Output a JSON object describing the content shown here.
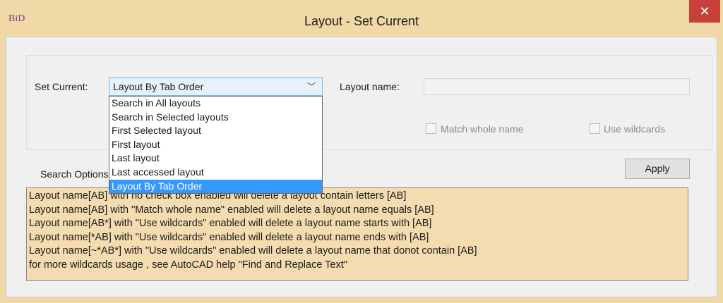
{
  "window": {
    "logo": "BiD",
    "title": "Layout - Set Current",
    "close_glyph": "✕"
  },
  "form": {
    "set_current_label": "Set Current:",
    "set_current_value": "Layout By Tab Order",
    "dropdown_arrow": "﹀",
    "layout_name_label": "Layout name:",
    "layout_name_value": "",
    "match_whole_name_label": "Match whole name",
    "use_wildcards_label": "Use wildcards",
    "search_options_label": "Search Options",
    "apply_label": "Apply"
  },
  "dropdown": {
    "options": [
      "Search in All layouts",
      "Search in Selected layouts",
      "First Selected layout",
      "First layout",
      "Last layout",
      "Last accessed layout",
      "Layout By Tab Order"
    ],
    "selected": "Layout By Tab Order"
  },
  "help_lines": [
    "Layout name[AB] with no check box enabled will delete a layout contain letters [AB]",
    "Layout name[AB] with \"Match whole name\" enabled will delete a layout name equals [AB]",
    "Layout name[AB*] with \"Use wildcards\" enabled will delete a layout name starts with [AB]",
    "Layout name[*AB] with \"Use wildcards\" enabled will delete a layout name ends with [AB]",
    "Layout name[~*AB*] with \"Use wildcards\" enabled will delete a layout name that donot contain [AB]",
    "for more wildcards usage , see AutoCAD help  \"Find and Replace Text\""
  ],
  "colors": {
    "frame": "#f0d9a6",
    "close_button": "#c7403a",
    "info_background": "#f5dcb0",
    "selection": "#3399ff"
  }
}
